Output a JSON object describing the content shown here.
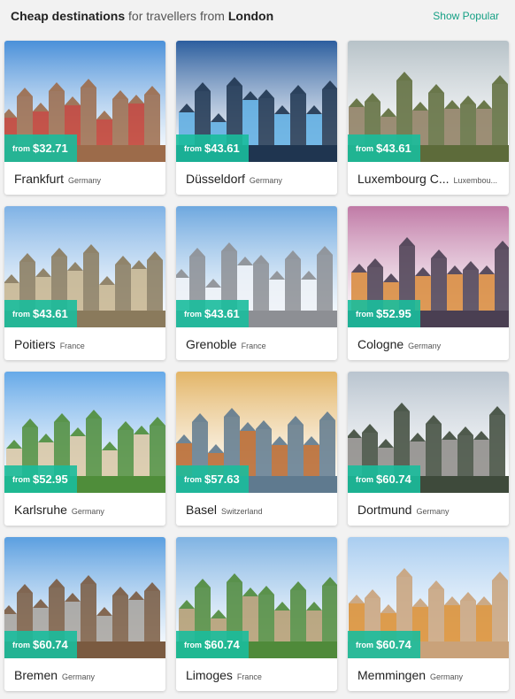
{
  "header": {
    "title_bold": "Cheap destinations",
    "title_mid": " for travellers from ",
    "title_origin": "London",
    "show_popular": "Show Popular"
  },
  "price_prefix": "from",
  "cards": [
    {
      "city": "Frankfurt",
      "country": "Germany",
      "price": "$32.71",
      "sky": "#4a90d9",
      "ground": "#9c6b4a",
      "accent": "#c0392b"
    },
    {
      "city": "Düsseldorf",
      "country": "Germany",
      "price": "$43.61",
      "sky": "#2c5e9e",
      "ground": "#1f3550",
      "accent": "#5dade2"
    },
    {
      "city": "Luxembourg C...",
      "country": "Luxembou...",
      "price": "$43.61",
      "sky": "#b7c2c8",
      "ground": "#5d6b3a",
      "accent": "#8c7b5e"
    },
    {
      "city": "Poitiers",
      "country": "France",
      "price": "$43.61",
      "sky": "#7fb2e5",
      "ground": "#8a7a5c",
      "accent": "#c7b48d"
    },
    {
      "city": "Grenoble",
      "country": "France",
      "price": "$43.61",
      "sky": "#6ea8df",
      "ground": "#8d8f94",
      "accent": "#eef2f7"
    },
    {
      "city": "Cologne",
      "country": "Germany",
      "price": "$52.95",
      "sky": "#c07aa6",
      "ground": "#4a3f52",
      "accent": "#d88a3a"
    },
    {
      "city": "Karlsruhe",
      "country": "Germany",
      "price": "$52.95",
      "sky": "#66a9e8",
      "ground": "#4f8d3a",
      "accent": "#d9c7a3"
    },
    {
      "city": "Basel",
      "country": "Switzerland",
      "price": "$57.63",
      "sky": "#e3b567",
      "ground": "#5f7a8f",
      "accent": "#b5652d"
    },
    {
      "city": "Dortmund",
      "country": "Germany",
      "price": "$60.74",
      "sky": "#b9c4cf",
      "ground": "#3e4a3b",
      "accent": "#8c8a86"
    },
    {
      "city": "Bremen",
      "country": "Germany",
      "price": "$60.74",
      "sky": "#5b9fe0",
      "ground": "#7a5a40",
      "accent": "#a7a29c"
    },
    {
      "city": "Limoges",
      "country": "France",
      "price": "$60.74",
      "sky": "#7fb3e3",
      "ground": "#4f8a3a",
      "accent": "#b39b6e"
    },
    {
      "city": "Memmingen",
      "country": "Germany",
      "price": "$60.74",
      "sky": "#a9cdf0",
      "ground": "#c9a27a",
      "accent": "#d98c2e"
    }
  ]
}
